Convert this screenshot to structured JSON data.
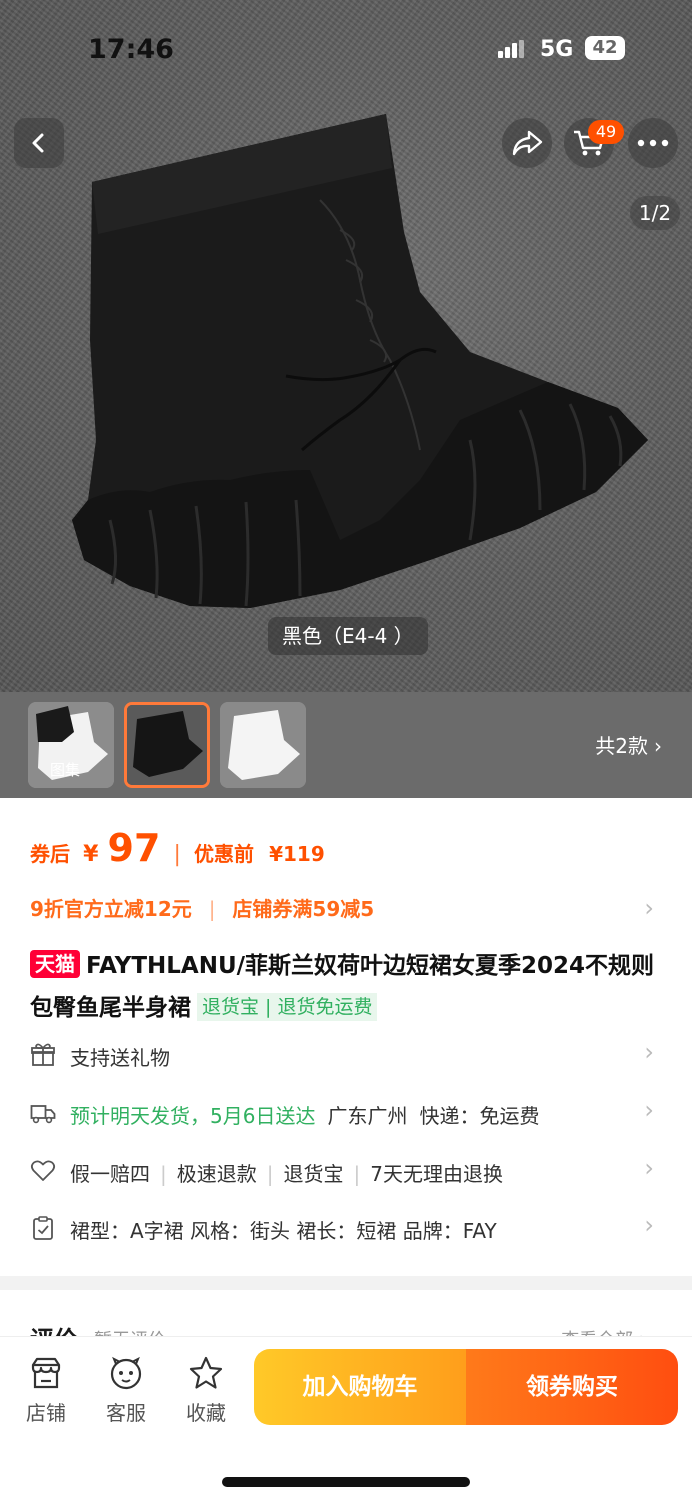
{
  "status_bar": {
    "time": "17:46",
    "network": "5G",
    "battery": "42"
  },
  "top_nav": {
    "cart_count": "49",
    "page_indicator": "1/2"
  },
  "image": {
    "variant_caption": "黑色（E4-4 ）"
  },
  "thumbnails": {
    "album_label": "图集",
    "variant_count": "共2款"
  },
  "price": {
    "after_coupon_label": "券后",
    "currency": "¥",
    "price": "97",
    "separator": "|",
    "before_label": "优惠前",
    "before_price": "¥119"
  },
  "promotions": {
    "official": "9折官方立减12元",
    "divider": "|",
    "store_coupon": "店铺券满59减5"
  },
  "product": {
    "tmall_badge": "天猫",
    "title": "FAYTHLANU/菲斯兰奴荷叶边短裙女夏季2024不规则包臀鱼尾半身裙",
    "return_tag": "退货宝 | 退货免运费"
  },
  "info_rows": {
    "gift": "支持送礼物",
    "shipping_estimate": "预计明天发货，5月6日送达",
    "shipping_origin": "广东广州",
    "shipping_fee": "快递：免运费",
    "services": [
      "假一赔四",
      "极速退款",
      "退货宝",
      "7天无理由退换"
    ],
    "attributes": "裙型：A字裙   风格：街头   裙长：短裙   品牌：FAY"
  },
  "reviews": {
    "title": "评价",
    "subtitle": "暂无评价",
    "view_all": "查看全部 >"
  },
  "bottom_bar": {
    "shop": "店铺",
    "service": "客服",
    "favorite": "收藏",
    "add_to_cart": "加入购物车",
    "buy_with_coupon": "领券购买"
  },
  "colors": {
    "accent": "#ff5000",
    "tmall_red": "#ff0036",
    "green": "#31b060",
    "cart_button": "#ffb020",
    "buy_button": "#ff5a14"
  }
}
